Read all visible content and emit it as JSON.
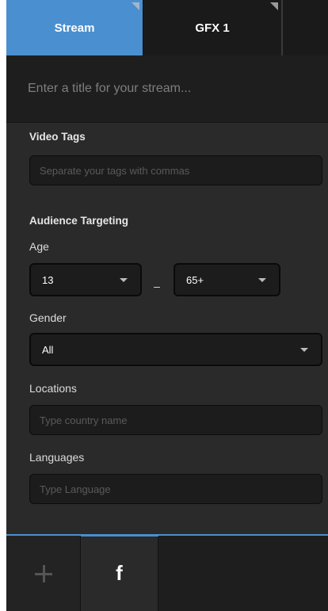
{
  "tabs": [
    {
      "label": "Stream",
      "active": true
    },
    {
      "label": "GFX 1",
      "active": false
    },
    {
      "label": "",
      "active": false
    }
  ],
  "stream": {
    "title_placeholder": "Enter a title for your stream...",
    "title_value": ""
  },
  "video_tags": {
    "label": "Video Tags",
    "placeholder": "Separate your tags with commas",
    "value": ""
  },
  "audience": {
    "label": "Audience Targeting",
    "age": {
      "label": "Age",
      "min": "13",
      "separator": "–",
      "max": "65+"
    },
    "gender": {
      "label": "Gender",
      "value": "All"
    },
    "locations": {
      "label": "Locations",
      "placeholder": "Type country name",
      "value": ""
    },
    "languages": {
      "label": "Languages",
      "placeholder": "Type Language",
      "value": ""
    }
  },
  "bottom_tabs": [
    {
      "icon": "plus-icon",
      "active": false
    },
    {
      "icon": "facebook-icon",
      "glyph": "f",
      "active": true
    }
  ],
  "colors": {
    "accent": "#4a8fd0",
    "panel": "#2a2a2a",
    "field": "#1c1c1c"
  }
}
